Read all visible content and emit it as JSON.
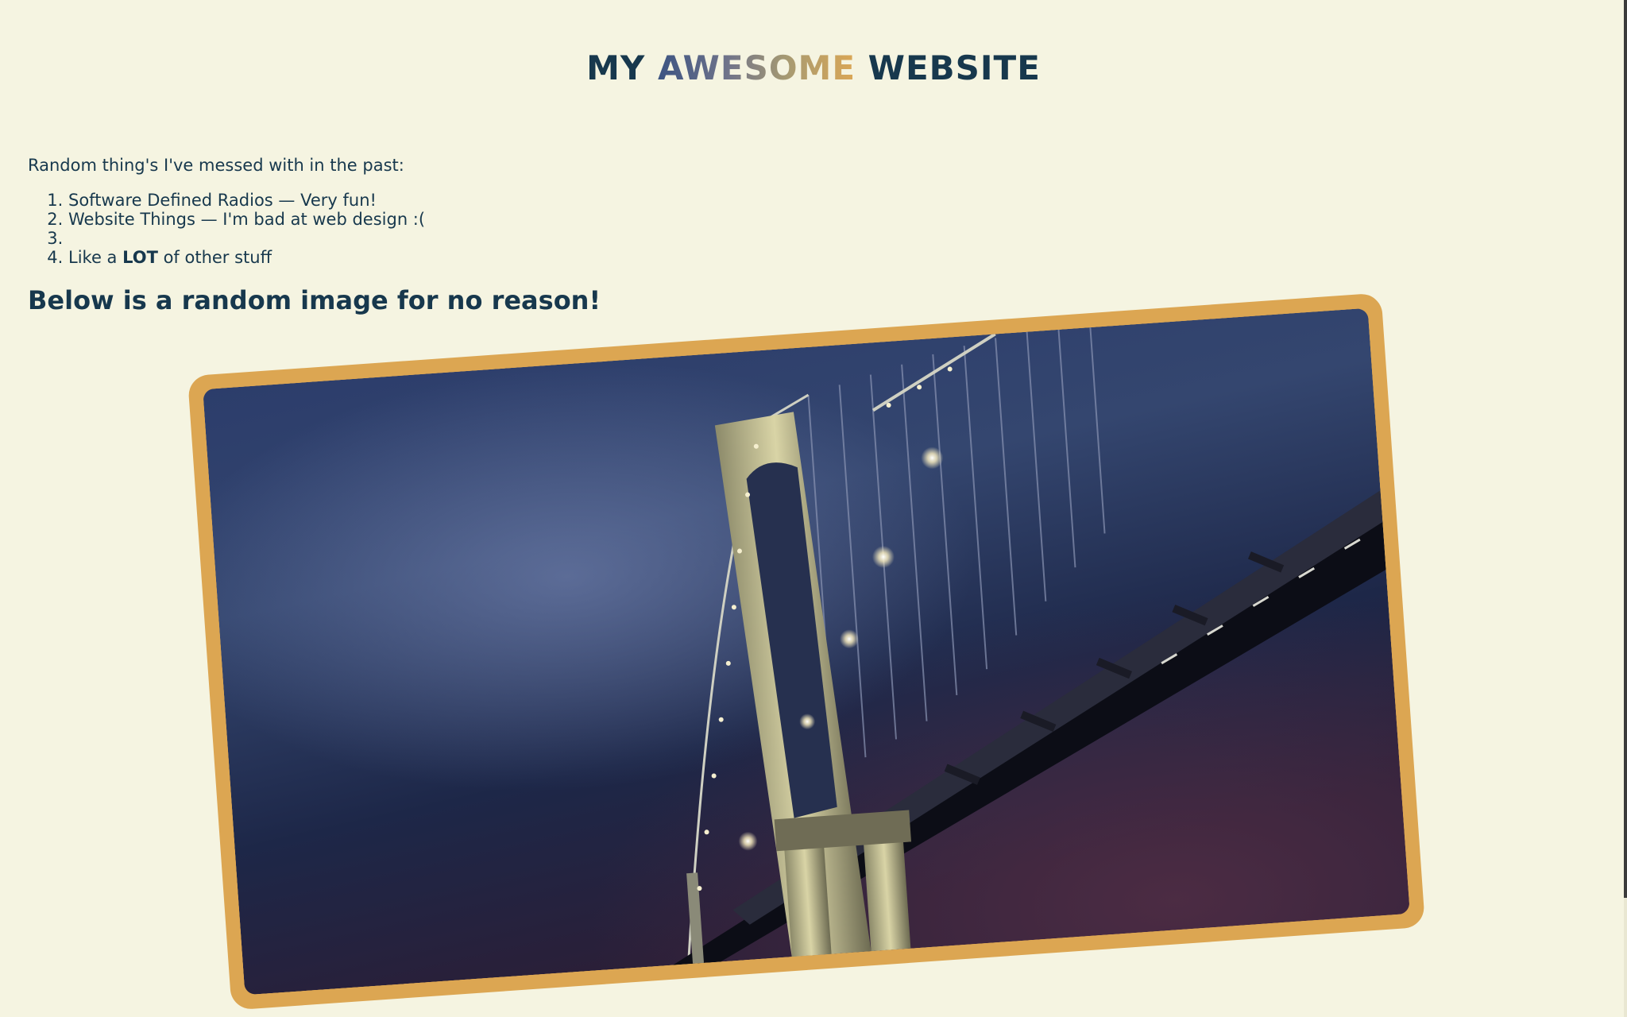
{
  "header": {
    "title_before": "MY",
    "title_accent": "AWESOME",
    "title_after": "WEBSITE"
  },
  "main": {
    "intro": "Random thing's I've messed with in the past:",
    "items": [
      {
        "text": "Software Defined Radios — Very fun!"
      },
      {
        "text": "Website Things — I'm bad at web design :("
      },
      {
        "text": ""
      },
      {
        "before": "Like a ",
        "bold": "LOT",
        "after": " of other stuff"
      }
    ],
    "image_heading": "Below is a random image for no reason!"
  },
  "colors": {
    "background": "#f5f4e1",
    "text": "#17384d",
    "frame": "#dca652",
    "gradient_start": "#3c5482",
    "gradient_end": "#dba755"
  }
}
